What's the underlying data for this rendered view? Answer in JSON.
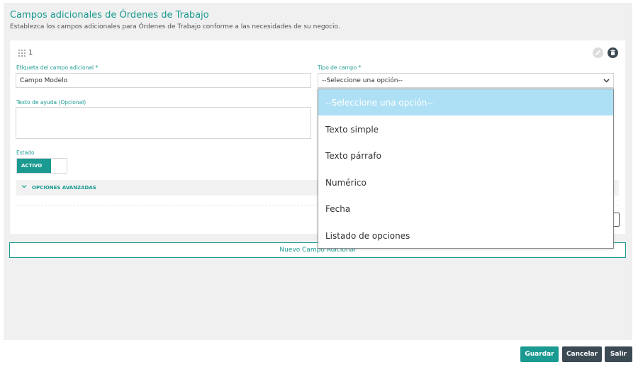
{
  "header": {
    "title": "Campos adicionales de Órdenes de Trabajo",
    "subtitle": "Establezca los campos adicionales para Órdenes de Trabajo conforme a las necesidades de su negocio."
  },
  "field_card": {
    "number": "1",
    "label_field": {
      "label": "Etiqueta del campo adicional *",
      "value": "Campo Modelo"
    },
    "type_field": {
      "label": "Tipo de campo *",
      "selected": "--Seleccione una opción--"
    },
    "help_field": {
      "label": "Texto de ayuda (Opcional)",
      "value": ""
    },
    "status": {
      "label": "Estado",
      "toggle_label": "ACTIVO"
    },
    "advanced": {
      "label": "OPCIONES AVANZADAS"
    }
  },
  "dropdown": {
    "options": [
      "--Seleccione una opción--",
      "Texto simple",
      "Texto párrafo",
      "Numérico",
      "Fecha",
      "Listado de opciones"
    ]
  },
  "new_field_button": "Nuevo Campo Adicional",
  "footer": {
    "save": "Guardar",
    "cancel": "Cancelar",
    "exit": "Salir"
  },
  "colors": {
    "accent": "#1a9a91",
    "dark": "#3c4a54",
    "highlight": "#aee0f5"
  }
}
